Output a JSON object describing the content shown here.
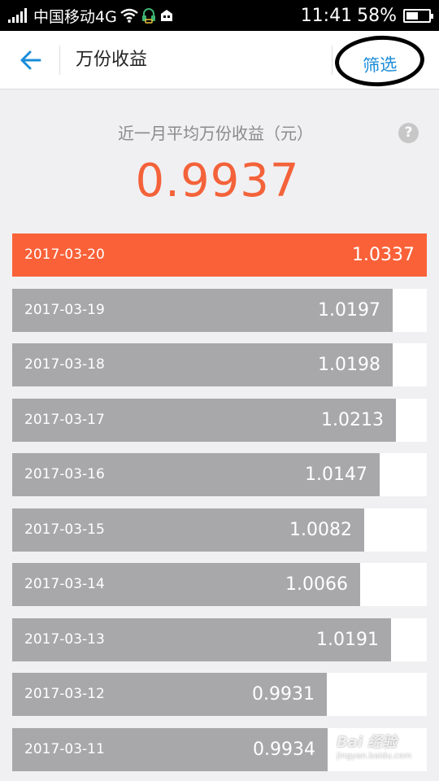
{
  "status_bar": {
    "carrier": "中国移动4G",
    "time": "11:41",
    "battery": "58%"
  },
  "header": {
    "back_icon": "back-arrow-icon",
    "title": "万份收益",
    "filter_label": "筛选"
  },
  "summary": {
    "label": "近一月平均万份收益（元）",
    "value": "0.9937",
    "help_icon": "?"
  },
  "rows": [
    {
      "date": "2017-03-20",
      "value": "1.0337",
      "active": true
    },
    {
      "date": "2017-03-19",
      "value": "1.0197",
      "active": false
    },
    {
      "date": "2017-03-18",
      "value": "1.0198",
      "active": false
    },
    {
      "date": "2017-03-17",
      "value": "1.0213",
      "active": false
    },
    {
      "date": "2017-03-16",
      "value": "1.0147",
      "active": false
    },
    {
      "date": "2017-03-15",
      "value": "1.0082",
      "active": false
    },
    {
      "date": "2017-03-14",
      "value": "1.0066",
      "active": false
    },
    {
      "date": "2017-03-13",
      "value": "1.0191",
      "active": false
    },
    {
      "date": "2017-03-12",
      "value": "0.9931",
      "active": false
    },
    {
      "date": "2017-03-11",
      "value": "0.9934",
      "active": false
    }
  ],
  "colors": {
    "accent": "#f4623a",
    "active_bar": "#fa6138",
    "bar": "#a8a8aa",
    "link": "#1a8cd8"
  },
  "watermark": {
    "logo": "Bai 经验",
    "sub": "jingyan.baidu.com"
  }
}
